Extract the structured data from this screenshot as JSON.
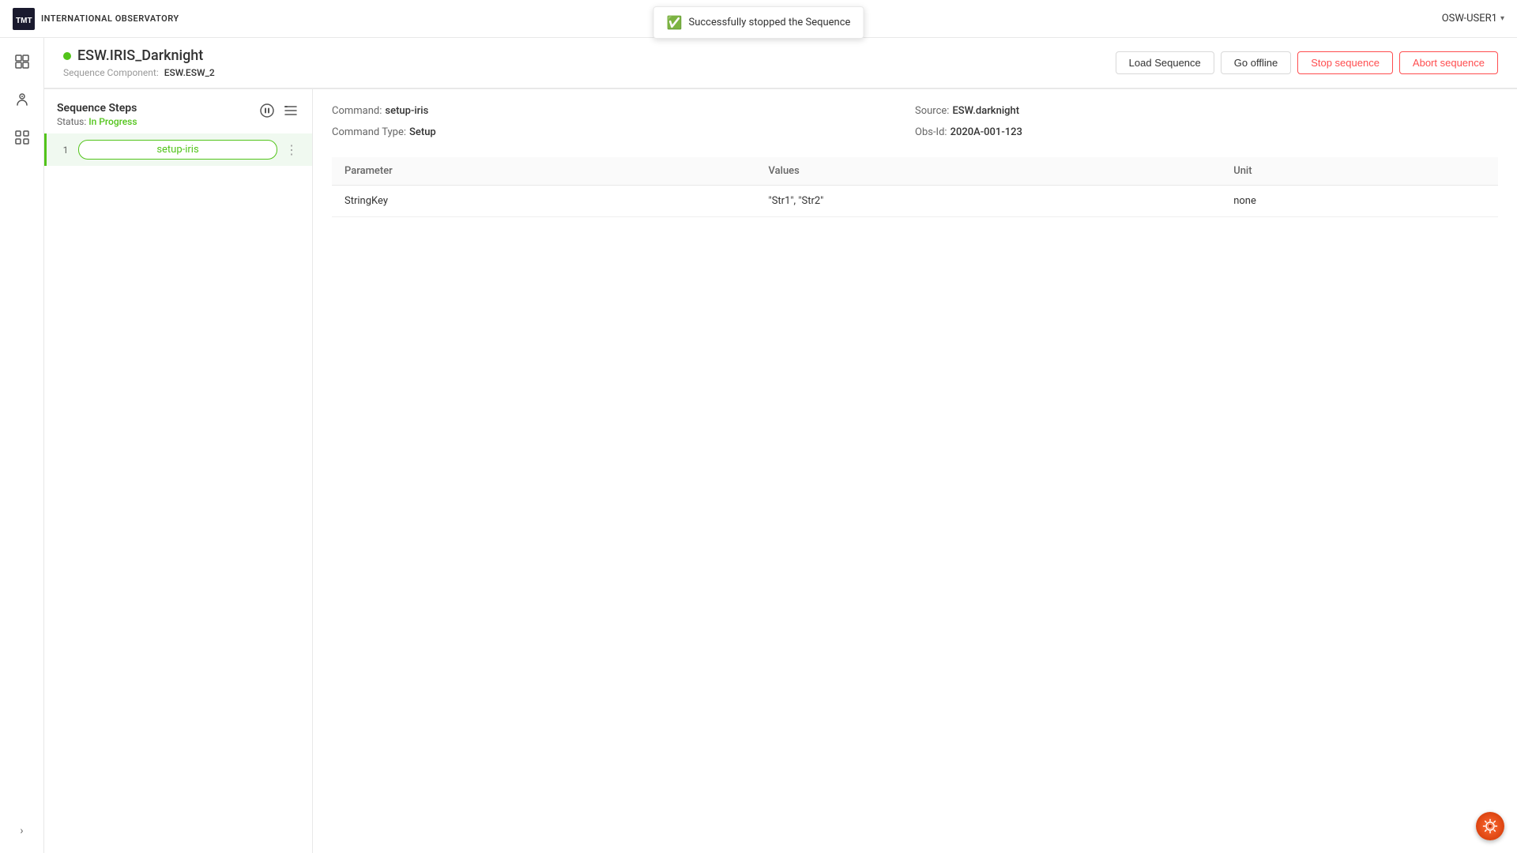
{
  "app": {
    "title": "INTERNATIONAL OBSERVATORY",
    "logo_text": "TMT"
  },
  "toast": {
    "message": "Successfully stopped the Sequence",
    "icon": "✓"
  },
  "user": {
    "name": "OSW-USER1",
    "chevron": "▾"
  },
  "sidebar": {
    "items": [
      {
        "icon": "⊞",
        "name": "grid-icon"
      },
      {
        "icon": "♾",
        "name": "scope-icon"
      },
      {
        "icon": "⊞",
        "name": "apps-icon"
      }
    ],
    "expand_icon": ">"
  },
  "page": {
    "title": "ESW.IRIS_Darknight",
    "status": "online",
    "subtitle_label": "Sequence Component:",
    "subtitle_value": "ESW.ESW_2"
  },
  "actions": {
    "load_sequence": "Load Sequence",
    "go_offline": "Go offline",
    "stop_sequence": "Stop sequence",
    "abort_sequence": "Abort sequence"
  },
  "steps_panel": {
    "title": "Sequence Steps",
    "status_label": "Status:",
    "status_value": "In Progress",
    "pause_icon": "⏸",
    "list_icon": "☰"
  },
  "step": {
    "number": "1",
    "label": "setup-iris",
    "menu_icon": "⋮"
  },
  "detail": {
    "command_label": "Command:",
    "command_value": "setup-iris",
    "command_type_label": "Command Type:",
    "command_type_value": "Setup",
    "source_label": "Source:",
    "source_value": "ESW.darknight",
    "obs_id_label": "Obs-Id:",
    "obs_id_value": "2020A-001-123"
  },
  "table": {
    "col_parameter": "Parameter",
    "col_values": "Values",
    "col_unit": "Unit",
    "rows": [
      {
        "parameter": "StringKey",
        "values": "\"Str1\", \"Str2\"",
        "unit": "none"
      }
    ]
  },
  "gear_icon": "⚙"
}
